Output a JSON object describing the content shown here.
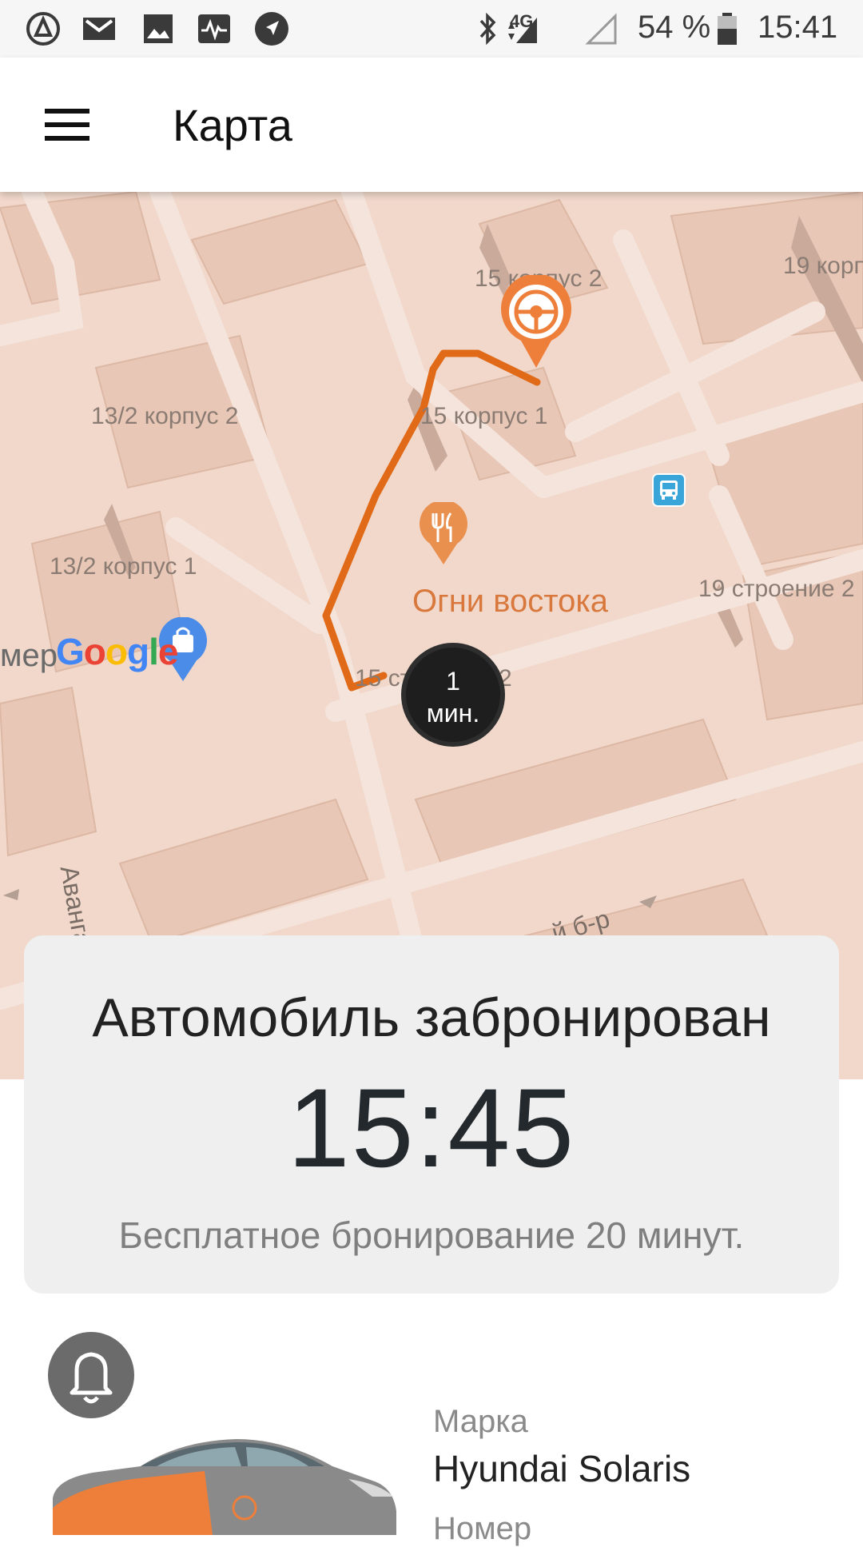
{
  "status_bar": {
    "network": "4G",
    "battery": "54 %",
    "time": "15:41"
  },
  "app_bar": {
    "title": "Карта"
  },
  "map": {
    "labels": {
      "l1": "15 корпус 2",
      "l2": "19 корп",
      "l3": "13/2 корпус 2",
      "l4": "15 корпус 1",
      "l5": "13/2 корпус 1",
      "l6": "19 строение 2",
      "l7": "15 ст",
      "l8": "2",
      "l9": "мер",
      "street1": "Авангардн",
      "street2": "й б-р"
    },
    "poi_name": "Огни востока",
    "route_time_value": "1",
    "route_time_unit": "мин.",
    "provider": "Google",
    "colors": {
      "route": "#e06a17",
      "pin": "#ee7f3a",
      "poi": "#e9904f",
      "bus_stop": "#3aa5d8"
    }
  },
  "booking": {
    "title": "Автомобиль забронирован",
    "until_time": "15:45",
    "note": "Бесплатное бронирование 20 минут."
  },
  "car": {
    "make_label": "Марка",
    "make_value": "Hyundai Solaris",
    "number_label": "Номер"
  }
}
